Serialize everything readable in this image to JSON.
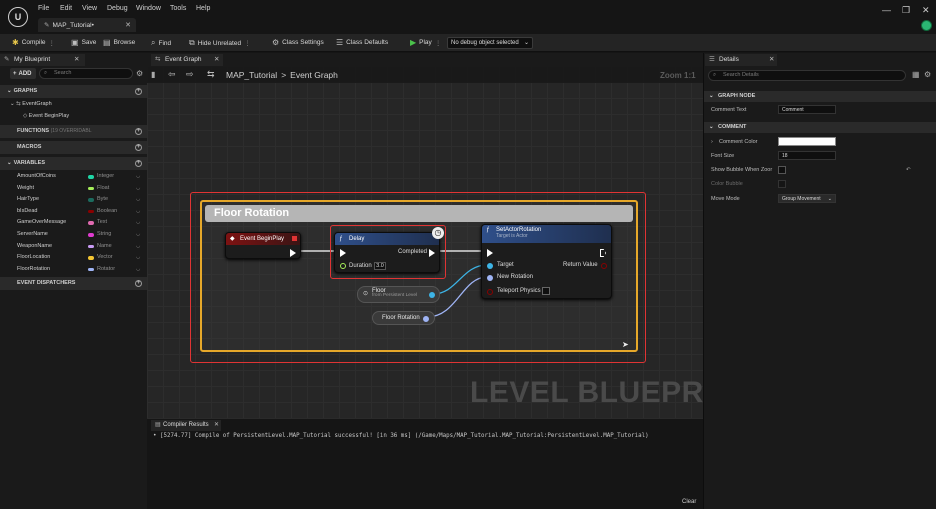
{
  "app": {
    "menu": [
      "File",
      "Edit",
      "View",
      "Debug",
      "Window",
      "Tools",
      "Help"
    ],
    "document_tab": "MAP_Tutorial•",
    "window_controls": [
      "—",
      "❐",
      "✕"
    ]
  },
  "toolbar": {
    "compile": "Compile",
    "save": "Save",
    "browse": "Browse",
    "find": "Find",
    "hide_unrelated": "Hide Unrelated",
    "class_settings": "Class Settings",
    "class_defaults": "Class Defaults",
    "play": "Play",
    "debug_object": "No debug object selected"
  },
  "my_blueprint": {
    "tab": "My Blueprint",
    "add": "ADD",
    "search_placeholder": "Search",
    "graphs_header": "GRAPHS",
    "event_graph": "EventGraph",
    "event_begin_play": "Event BeginPlay",
    "functions_header": "FUNCTIONS",
    "functions_count": "(19 OVERRIDABL",
    "macros_header": "MACROS",
    "variables_header": "VARIABLES",
    "dispatchers_header": "EVENT DISPATCHERS",
    "variables": [
      {
        "name": "AmountOfCoins",
        "type": "Integer",
        "color": "#1fd6a6"
      },
      {
        "name": "Weight",
        "type": "Float",
        "color": "#a6f05a"
      },
      {
        "name": "HairType",
        "type": "Byte",
        "color": "#1c6b5e"
      },
      {
        "name": "bIsDead",
        "type": "Boolean",
        "color": "#8a0000"
      },
      {
        "name": "GameOverMessage",
        "type": "Text",
        "color": "#e06ab0"
      },
      {
        "name": "ServerName",
        "type": "String",
        "color": "#e03cd0"
      },
      {
        "name": "WeaponName",
        "type": "Name",
        "color": "#c99cf5"
      },
      {
        "name": "FloorLocation",
        "type": "Vector",
        "color": "#f5c632"
      },
      {
        "name": "FloorRotation",
        "type": "Rotator",
        "color": "#9fb4f5"
      }
    ]
  },
  "graph": {
    "tab": "Event Graph",
    "breadcrumb_root": "MAP_Tutorial",
    "breadcrumb_sep": ">",
    "breadcrumb_leaf": "Event Graph",
    "zoom": "Zoom 1:1",
    "watermark": "LEVEL BLUEPRINT",
    "comment_title": "Floor Rotation",
    "nodes": {
      "begin_play": "Event BeginPlay",
      "delay": "Delay",
      "delay_completed": "Completed",
      "delay_duration": "Duration",
      "delay_value": "3.0",
      "set_rot": "SetActorRotation",
      "set_rot_sub": "Target is Actor",
      "target": "Target",
      "return_value": "Return Value",
      "new_rotation": "New Rotation",
      "teleport": "Teleport Physics",
      "floor": "Floor",
      "floor_sub": "from Persistent Level",
      "floor_rotation": "Floor Rotation"
    }
  },
  "compiler": {
    "tab": "Compiler Results",
    "line": "• [5274.77] Compile of PersistentLevel.MAP_Tutorial successful! [in 36 ms] (/Game/Maps/MAP_Tutorial.MAP_Tutorial:PersistentLevel.MAP_Tutorial)",
    "clear": "Clear"
  },
  "details": {
    "tab": "Details",
    "search_placeholder": "Search Details",
    "graph_node_header": "GRAPH NODE",
    "comment_text_label": "Comment Text",
    "comment_text_value": "Comment",
    "comment_header": "COMMENT",
    "comment_color_label": "Comment Color",
    "font_size_label": "Font Size",
    "font_size_value": "18",
    "show_bubble_label": "Show Bubble When Zoor",
    "color_bubble_label": "Color Bubble",
    "move_mode_label": "Move Mode",
    "move_mode_value": "Group Movement"
  }
}
